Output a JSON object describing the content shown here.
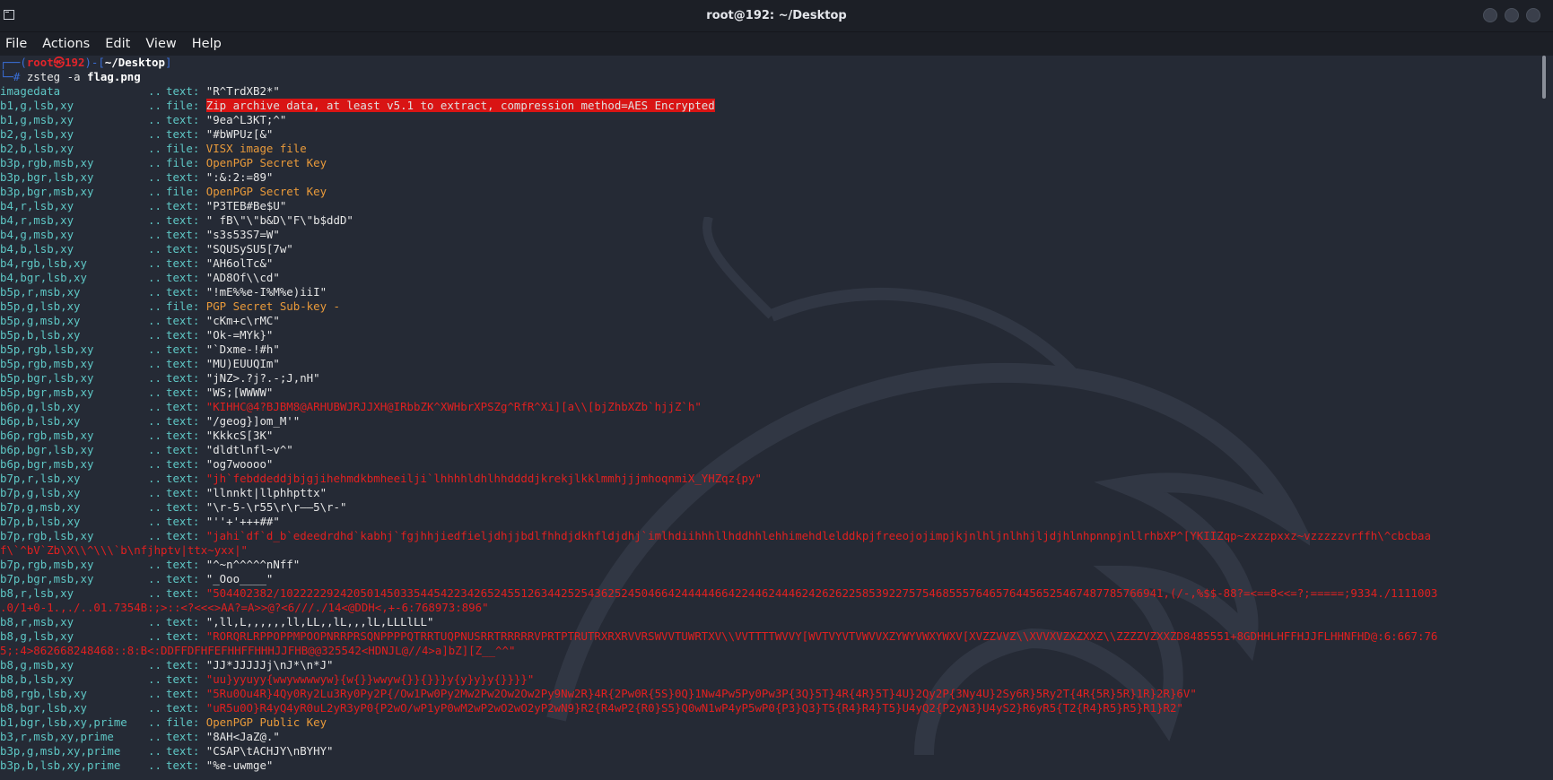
{
  "window": {
    "title": "root@192: ~/Desktop"
  },
  "menu": [
    "File",
    "Actions",
    "Edit",
    "View",
    "Help"
  ],
  "prompt": {
    "user_host": "root㉿192",
    "path": "~/Desktop",
    "command": "zsteg",
    "flags": "-a",
    "file": "flag.png"
  },
  "rows": [
    {
      "key": "imagedata",
      "kind": "text:",
      "val": "\"R^TrdXB2*\"",
      "style": ""
    },
    {
      "key": "b1,g,lsb,xy",
      "kind": "file:",
      "val": "Zip archive data, at least v5.1 to extract, compression method=AES Encrypted",
      "style": "hl"
    },
    {
      "key": "b1,g,msb,xy",
      "kind": "text:",
      "val": "\"9ea^L3KT;^\"",
      "style": ""
    },
    {
      "key": "b2,g,lsb,xy",
      "kind": "text:",
      "val": "\"#bWPUz[&\"",
      "style": ""
    },
    {
      "key": "b2,b,lsb,xy",
      "kind": "file:",
      "val": "VISX image file",
      "style": "orange"
    },
    {
      "key": "b3p,rgb,msb,xy",
      "kind": "file:",
      "val": "OpenPGP Secret Key",
      "style": "orange"
    },
    {
      "key": "b3p,bgr,lsb,xy",
      "kind": "text:",
      "val": "\":&:2:=89\"",
      "style": ""
    },
    {
      "key": "b3p,bgr,msb,xy",
      "kind": "file:",
      "val": "OpenPGP Secret Key",
      "style": "orange"
    },
    {
      "key": "b4,r,lsb,xy",
      "kind": "text:",
      "val": "\"P3TEB#Be$U\"",
      "style": ""
    },
    {
      "key": "b4,r,msb,xy",
      "kind": "text:",
      "val": "\" fB\\\"\\\"b&D\\\"F\\\"b$ddD\"",
      "style": ""
    },
    {
      "key": "b4,g,msb,xy",
      "kind": "text:",
      "val": "\"s3s53S7=W\"",
      "style": ""
    },
    {
      "key": "b4,b,lsb,xy",
      "kind": "text:",
      "val": "\"SQUSySU5[7w\"",
      "style": ""
    },
    {
      "key": "b4,rgb,lsb,xy",
      "kind": "text:",
      "val": "\"AH6olTc&\"",
      "style": ""
    },
    {
      "key": "b4,bgr,lsb,xy",
      "kind": "text:",
      "val": "\"AD8Of\\\\cd\"",
      "style": ""
    },
    {
      "key": "b5p,r,msb,xy",
      "kind": "text:",
      "val": "\"!mE%%e-I%M%e)iiI\"",
      "style": ""
    },
    {
      "key": "b5p,g,lsb,xy",
      "kind": "file:",
      "val": "PGP Secret Sub-key -",
      "style": "orange"
    },
    {
      "key": "b5p,g,msb,xy",
      "kind": "text:",
      "val": "\"cKm+c\\rMC\"",
      "style": ""
    },
    {
      "key": "b5p,b,lsb,xy",
      "kind": "text:",
      "val": "\"Ok-=MYk}\"",
      "style": ""
    },
    {
      "key": "b5p,rgb,lsb,xy",
      "kind": "text:",
      "val": "\"`Dxme-!#h\"",
      "style": ""
    },
    {
      "key": "b5p,rgb,msb,xy",
      "kind": "text:",
      "val": "\"MU)EUUQIm\"",
      "style": ""
    },
    {
      "key": "b5p,bgr,lsb,xy",
      "kind": "text:",
      "val": "\"jNZ>.?j?.-;J,nH\"",
      "style": ""
    },
    {
      "key": "b5p,bgr,msb,xy",
      "kind": "text:",
      "val": "\"WS;[WWWW\"",
      "style": ""
    },
    {
      "key": "b6p,g,lsb,xy",
      "kind": "text:",
      "val": "\"KIHHC@4?BJBM8@ARHUBWJRJJXH@IRbbZK^XWHbrXPSZg^RfR^Xi][a\\\\[bjZhbXZb`hjjZ`h\"",
      "style": "red"
    },
    {
      "key": "b6p,b,lsb,xy",
      "kind": "text:",
      "val": "\"/geog}]om_M'\"",
      "style": ""
    },
    {
      "key": "b6p,rgb,msb,xy",
      "kind": "text:",
      "val": "\"KkkcS[3K\"",
      "style": ""
    },
    {
      "key": "b6p,bgr,lsb,xy",
      "kind": "text:",
      "val": "\"dldtlnfl~v^\"",
      "style": ""
    },
    {
      "key": "b6p,bgr,msb,xy",
      "kind": "text:",
      "val": "\"og7woooo\"",
      "style": ""
    },
    {
      "key": "b7p,r,lsb,xy",
      "kind": "text:",
      "val": "\"jh`febddeddjbjgjihehmdkbmheeilji`lhhhhldhlhhddddjkrekjlkklmmhjjjmhoqnmiX_YHZqz{py\"",
      "style": "red"
    },
    {
      "key": "b7p,g,lsb,xy",
      "kind": "text:",
      "val": "\"llnnkt|llphhpttx\"",
      "style": ""
    },
    {
      "key": "b7p,g,msb,xy",
      "kind": "text:",
      "val": "\"\\r-5-\\r55\\r\\r——5\\r-\"",
      "style": ""
    },
    {
      "key": "b7p,b,lsb,xy",
      "kind": "text:",
      "val": "\"''+'+++##\"",
      "style": ""
    },
    {
      "key": "b7p,rgb,lsb,xy",
      "kind": "text:",
      "val": "\"jahi`df`d_b`edeedrdhd`kabhj`fgjhhjiedfieljdhjjbdlfhhdjdkhfldjdhj`imlhdiihhhllhddhhlehhimehdlelddkpjfreeojojimpjkjnlhljnlhhjljdjhlnhpnnpjnllrhbXP^[YKIIZqp~zxzzpxxz~vzzzzzvrffh\\^cbcbaa",
      "wrap": "f\\`^bV`Zb\\X\\\\^\\\\\\`b\\nfjhptv|ttx~yxx|\"",
      "style": "red"
    },
    {
      "key": "b7p,rgb,msb,xy",
      "kind": "text:",
      "val": "\"^~n^^^^^nNff\"",
      "style": ""
    },
    {
      "key": "b7p,bgr,msb,xy",
      "kind": "text:",
      "val": "\"_Ooo____\"",
      "style": ""
    },
    {
      "key": "b8,r,lsb,xy",
      "kind": "text:",
      "val": "\"504402382/102222292420501450335445422342652455126344252543625245046642444446642244624446242626225853922757546855576465764456525467487785766941,(/-,%$$-88?=<==8<<=?;=====;9334./1111003",
      "wrap": ".0/1+0-1.,./..01.7354B:;>::<?<<<>AA?=A>>@?<6///./14<@DDH<,+-6:768973:896\"",
      "style": "red"
    },
    {
      "key": "b8,r,msb,xy",
      "kind": "text:",
      "val": "\",ll,L,,,,,,ll,LL,,lL,,,lL,LLLlLL\"",
      "style": ""
    },
    {
      "key": "b8,g,lsb,xy",
      "kind": "text:",
      "val": "\"RORQRLRPPOPPMPOOPNRRPRSQNPPPPQTRRTUQPNUSRRTRRRRRVPRTPTRUTRXRXRVVRSWVVTUWRTXV\\\\VVTTTTWVVY[WVTVYVTVWVVXZYWYVWXYWXV[XVZZVVZ\\\\XVVXVZXZXXZ\\\\ZZZZVZXXZD8485551+8GDHHLHFFHJJFLHHNFHD@:6:667:76",
      "wrap": "5;:4>862668248468::8:B<:DDFFDFHFEFHHFFHHHJJFHB@@325542<HDNJL@//4>a]bZ][Z__^^\"",
      "style": "red"
    },
    {
      "key": "b8,g,msb,xy",
      "kind": "text:",
      "val": "\"JJ*JJJJJj\\nJ*\\n*J\"",
      "style": ""
    },
    {
      "key": "b8,b,lsb,xy",
      "kind": "text:",
      "val": "\"uu}yyuyy{wwywwwwyw}{w{}}wwyw{}}{}}}y{y}y}y{}}}}\"",
      "style": "red"
    },
    {
      "key": "b8,rgb,lsb,xy",
      "kind": "text:",
      "val": "\"5Ru0Ou4R}4Qy0Ry2Lu3Ry0Py2P{/Ow1Pw0Py2Mw2Pw2Ow2Ow2Py9Nw2R}4R{2Pw0R{5S}0Q}1Nw4Pw5Py0Pw3P{3Q}5T}4R{4R}5T}4U}2Qy2P{3Ny4U}2Sy6R}5Ry2T{4R{5R}5R}1R}2R}6V\"",
      "style": "red"
    },
    {
      "key": "b8,bgr,lsb,xy",
      "kind": "text:",
      "val": "\"uR5u0O}R4yQ4yR0uL2yR3yP0{P2wO/wP1yP0wM2wP2wO2wO2yP2wN9}R2{R4wP2{R0}S5}Q0wN1wP4yP5wP0{P3}Q3}T5{R4}R4}T5}U4yQ2{P2yN3}U4yS2}R6yR5{T2{R4}R5}R5}R1}R2\"",
      "style": "red"
    },
    {
      "key": "b1,bgr,lsb,xy,prime",
      "kind": "file:",
      "val": "OpenPGP Public Key",
      "style": "orange"
    },
    {
      "key": "b3,r,msb,xy,prime",
      "kind": "text:",
      "val": "\"8AH<JaZ@.\"",
      "style": ""
    },
    {
      "key": "b3p,g,msb,xy,prime",
      "kind": "text:",
      "val": "\"CSAP\\tACHJY\\nBYHY\"",
      "style": ""
    },
    {
      "key": "b3p,b,lsb,xy,prime",
      "kind": "text:",
      "val": "\"%e-uwmge\"",
      "style": ""
    }
  ]
}
